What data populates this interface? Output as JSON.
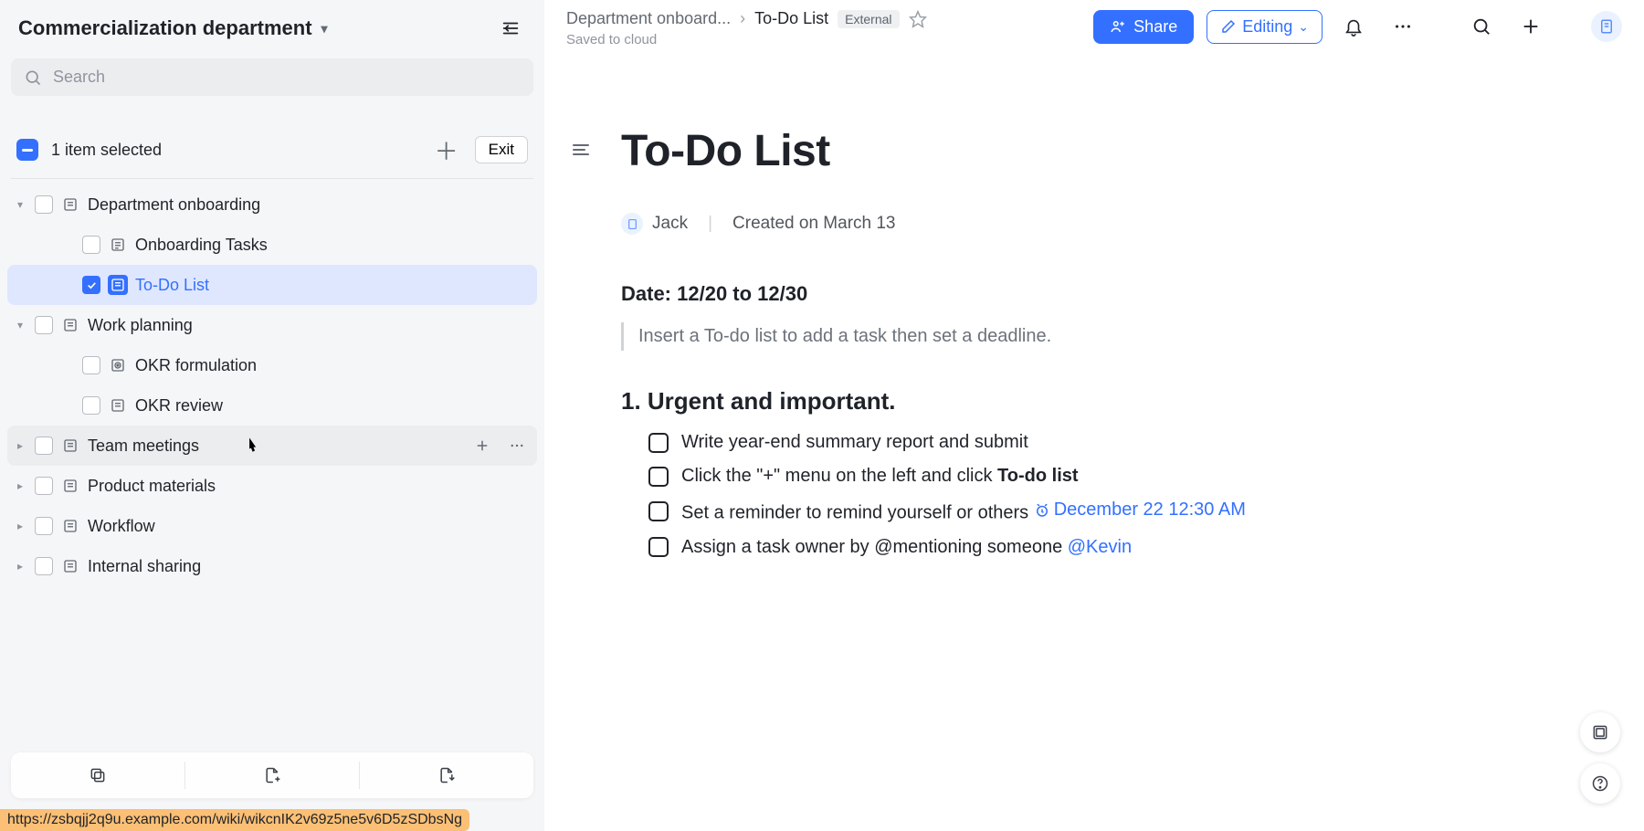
{
  "workspace": {
    "title": "Commercialization department"
  },
  "search": {
    "placeholder": "Search"
  },
  "selection": {
    "count_text": "1 item selected",
    "exit_label": "Exit"
  },
  "tree": [
    {
      "id": "dept",
      "label": "Department onboarding",
      "level": 0,
      "twisty": "▾",
      "checked": false,
      "iconType": "doc",
      "selected": false,
      "hovered": false
    },
    {
      "id": "onb-tasks",
      "label": "Onboarding Tasks",
      "level": 1,
      "twisty": "",
      "checked": false,
      "iconType": "list",
      "selected": false,
      "hovered": false
    },
    {
      "id": "todo",
      "label": "To-Do List",
      "level": 1,
      "twisty": "",
      "checked": true,
      "iconType": "doc-filled",
      "selected": true,
      "hovered": false
    },
    {
      "id": "work",
      "label": "Work planning",
      "level": 0,
      "twisty": "▾",
      "checked": false,
      "iconType": "doc",
      "selected": false,
      "hovered": false
    },
    {
      "id": "okr-f",
      "label": "OKR formulation",
      "level": 1,
      "twisty": "",
      "checked": false,
      "iconType": "target",
      "selected": false,
      "hovered": false
    },
    {
      "id": "okr-r",
      "label": "OKR review",
      "level": 1,
      "twisty": "",
      "checked": false,
      "iconType": "doc",
      "selected": false,
      "hovered": false
    },
    {
      "id": "team",
      "label": "Team meetings",
      "level": 0,
      "twisty": "▸",
      "checked": false,
      "iconType": "doc",
      "selected": false,
      "hovered": true
    },
    {
      "id": "prod",
      "label": "Product materials",
      "level": 0,
      "twisty": "▸",
      "checked": false,
      "iconType": "doc",
      "selected": false,
      "hovered": false
    },
    {
      "id": "wf",
      "label": "Workflow",
      "level": 0,
      "twisty": "▸",
      "checked": false,
      "iconType": "doc",
      "selected": false,
      "hovered": false
    },
    {
      "id": "int",
      "label": "Internal sharing",
      "level": 0,
      "twisty": "▸",
      "checked": false,
      "iconType": "doc",
      "selected": false,
      "hovered": false
    }
  ],
  "breadcrumb": {
    "first": "Department onboard...",
    "last": "To-Do List",
    "badge": "External",
    "saved": "Saved to cloud"
  },
  "toolbar": {
    "share_label": "Share",
    "editing_label": "Editing"
  },
  "doc": {
    "title": "To-Do List",
    "author": "Jack",
    "created_label": "Created on March 13",
    "date_line": "Date: 12/20 to 12/30",
    "tip": "Insert a To-do list to add a task then set a deadline.",
    "section_heading": "1. Urgent and important.",
    "tasks": {
      "0": {
        "text": "Write year-end summary report and submit"
      },
      "1": {
        "prefix": "Click the \"+\" menu on the left and click ",
        "bold": "To-do list"
      },
      "2": {
        "prefix": "Set a reminder to remind yourself or others ",
        "date": "December 22 12:30 AM"
      },
      "3": {
        "prefix": "Assign a task owner by @mentioning someone ",
        "mention": "@Kevin"
      }
    }
  },
  "url_hint": "https://zsbqjj2q9u.example.com/wiki/wikcnIK2v69z5ne5v6D5zSDbsNg"
}
